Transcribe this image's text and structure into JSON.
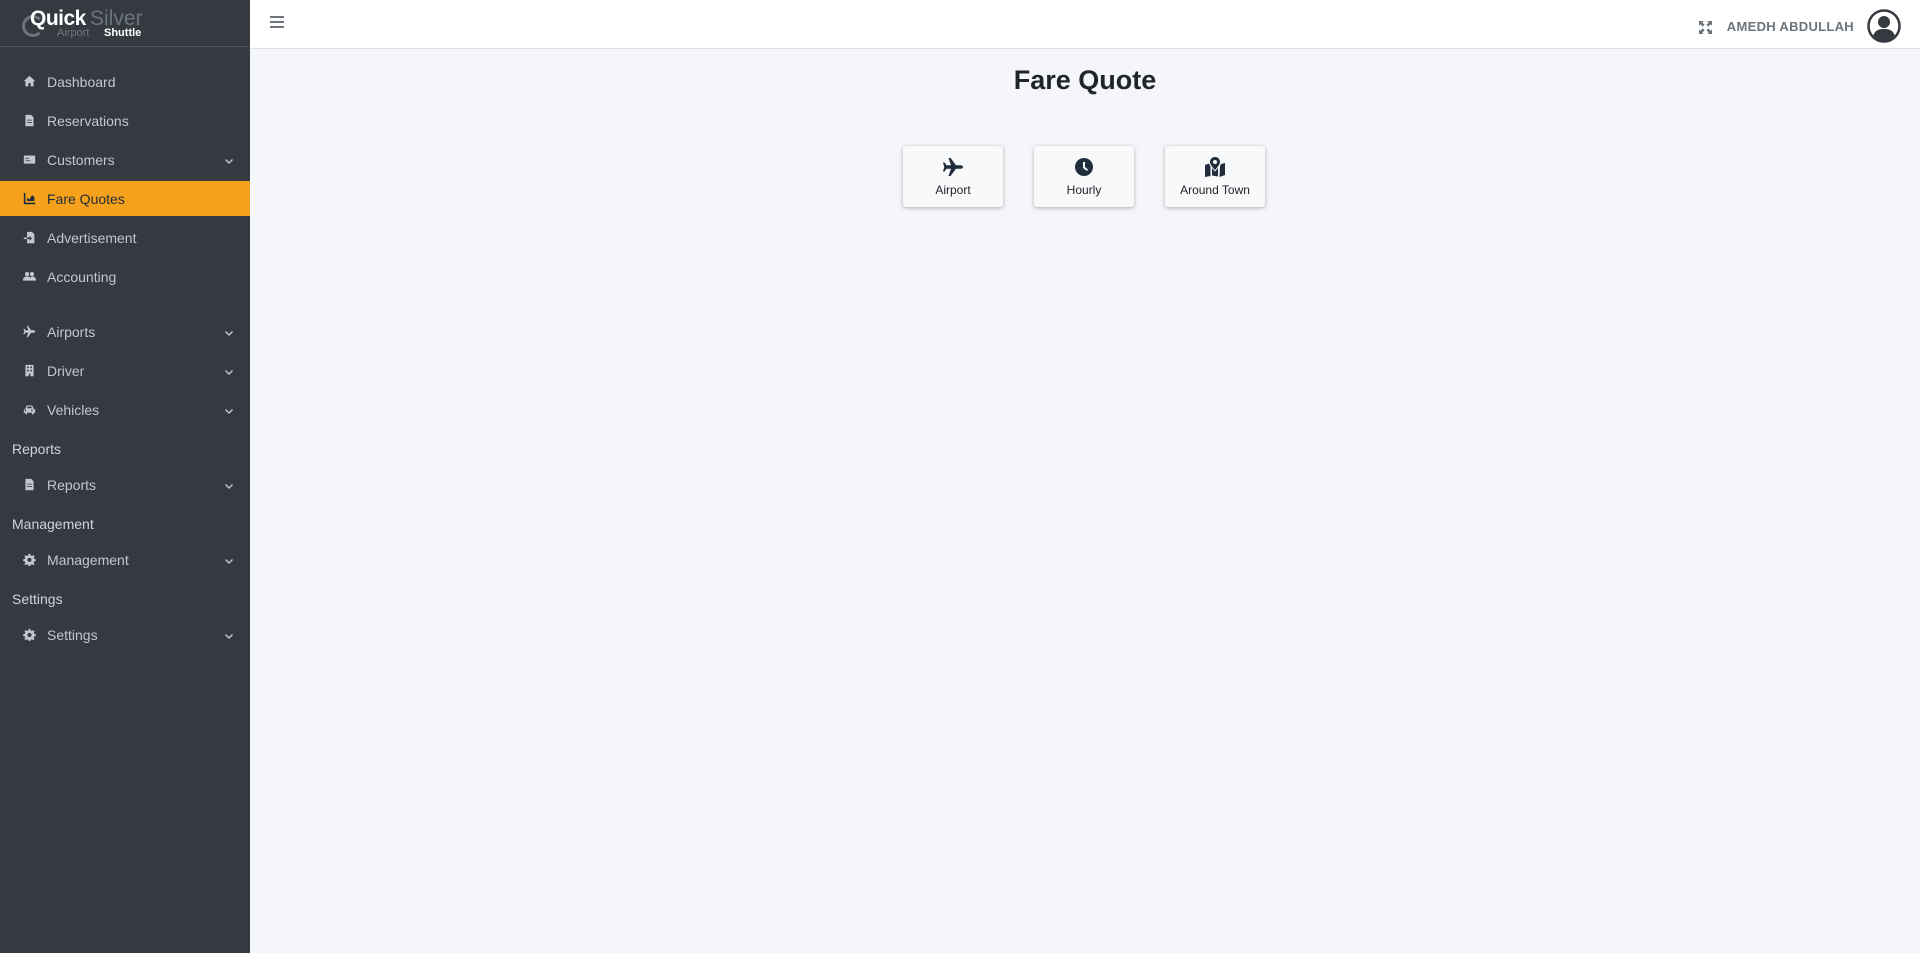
{
  "brand": {
    "quick": "Quick",
    "silver": "Silver",
    "airport": "Airport",
    "shuttle": "Shuttle"
  },
  "sidebar": {
    "items": [
      {
        "label": "Dashboard",
        "icon": "home-icon"
      },
      {
        "label": "Reservations",
        "icon": "file-icon"
      },
      {
        "label": "Customers",
        "icon": "id-card-icon",
        "has_submenu": true
      },
      {
        "label": "Fare Quotes",
        "icon": "chart-icon",
        "active": true
      },
      {
        "label": "Advertisement",
        "icon": "file-import-icon"
      },
      {
        "label": "Accounting",
        "icon": "users-icon"
      },
      {
        "label": "Airports",
        "icon": "plane-icon",
        "has_submenu": true
      },
      {
        "label": "Driver",
        "icon": "building-icon",
        "has_submenu": true
      },
      {
        "label": "Vehicles",
        "icon": "car-icon",
        "has_submenu": true
      },
      {
        "label": "Reports",
        "icon": "file-icon",
        "has_submenu": true
      },
      {
        "label": "Management",
        "icon": "gear-icon",
        "has_submenu": true
      },
      {
        "label": "Settings",
        "icon": "gear-icon",
        "has_submenu": true
      }
    ],
    "headers": {
      "reports": "Reports",
      "management": "Management",
      "settings": "Settings"
    }
  },
  "topbar": {
    "username": "AMEDH ABDULLAH"
  },
  "main": {
    "title": "Fare Quote",
    "cards": [
      {
        "label": "Airport",
        "icon": "plane-icon"
      },
      {
        "label": "Hourly",
        "icon": "clock-icon"
      },
      {
        "label": "Around Town",
        "icon": "map-marker-icon"
      }
    ]
  },
  "colors": {
    "sidebar_bg": "#343a40",
    "active_bg": "#f6a11b",
    "content_bg": "#f4f6f9"
  }
}
